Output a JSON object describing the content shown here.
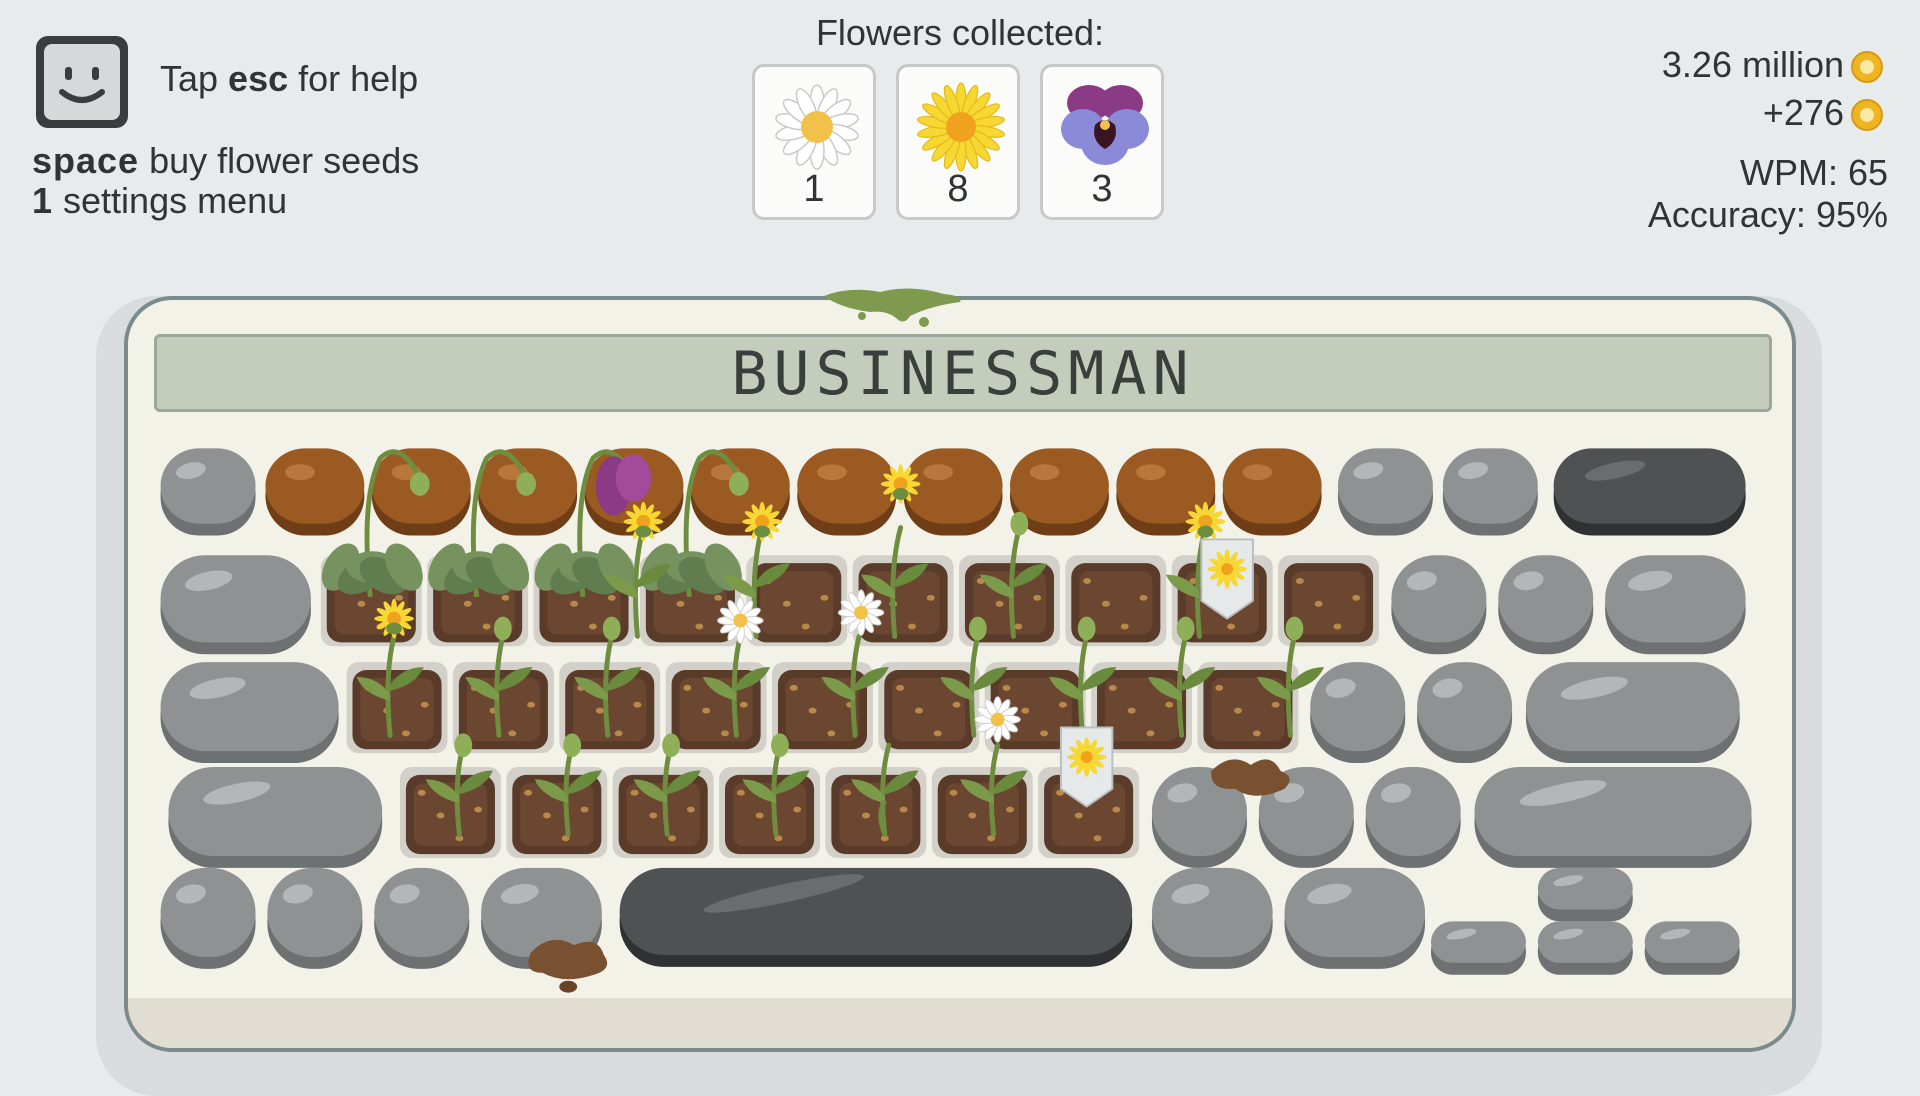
{
  "help": {
    "prefix": "Tap ",
    "key": "esc",
    "suffix": " for help"
  },
  "hotkeys": [
    {
      "key": "space",
      "label": "buy flower seeds"
    },
    {
      "key": "1",
      "label": "settings menu"
    }
  ],
  "flowers": {
    "title": "Flowers collected:",
    "items": [
      {
        "name": "daisy",
        "icon": "daisy-icon",
        "count": "1"
      },
      {
        "name": "dandelion",
        "icon": "dandelion-icon",
        "count": "8"
      },
      {
        "name": "pansy",
        "icon": "pansy-icon",
        "count": "3"
      }
    ]
  },
  "stats": {
    "coins": "3.26 million",
    "gain": "+276",
    "wpm": "WPM: 65",
    "accuracy": "Accuracy: 95%"
  },
  "word": "BUSINESSMAN",
  "colors": {
    "background": "#e8ebeb",
    "keyboard": "#f3f2e9",
    "stone": "#8f9293",
    "stone_dark": "#4f5253",
    "soil_mound": "#9a5a22",
    "soil_bed": "#5a3b2a",
    "lcd": "#c4ccbb",
    "coin": "#f0b324"
  },
  "keyboard": {
    "rows": [
      [
        "stone",
        "mound",
        "mound",
        "mound",
        "mound",
        "mound",
        "mound",
        "mound",
        "mound",
        "mound",
        "mound",
        "stone",
        "stone",
        "dark-wide"
      ],
      [
        "stone-wide",
        "bed",
        "bed",
        "bed",
        "bed",
        "bed",
        "bed",
        "bed",
        "bed",
        "bed",
        "bed",
        "stone",
        "stone",
        "stone-wide"
      ],
      [
        "stone-wide",
        "bed",
        "bed",
        "bed",
        "bed",
        "bed",
        "bed",
        "bed",
        "bed",
        "bed",
        "stone",
        "stone",
        "stone-wide"
      ],
      [
        "stone-wide",
        "bed",
        "bed",
        "bed",
        "bed",
        "bed",
        "bed",
        "bed",
        "stone",
        "stone",
        "stone",
        "stone-wide"
      ],
      [
        "stone",
        "stone",
        "stone",
        "stone",
        "spacebar",
        "stone",
        "stone",
        "arrows"
      ]
    ]
  }
}
